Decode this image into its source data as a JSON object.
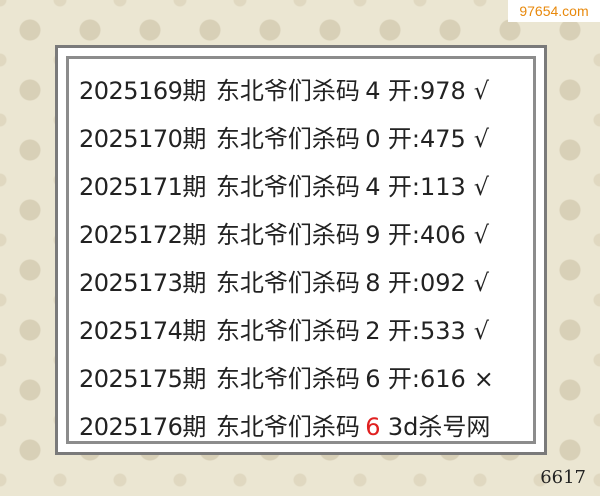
{
  "watermark": "97654.com",
  "rows": [
    {
      "period": "2025169期",
      "label": "东北爷们杀码",
      "kill": "4",
      "open": "开:978",
      "mark": "√"
    },
    {
      "period": "2025170期",
      "label": "东北爷们杀码",
      "kill": "0",
      "open": "开:475",
      "mark": "√"
    },
    {
      "period": "2025171期",
      "label": "东北爷们杀码",
      "kill": "4",
      "open": "开:113",
      "mark": "√"
    },
    {
      "period": "2025172期",
      "label": "东北爷们杀码",
      "kill": "9",
      "open": "开:406",
      "mark": "√"
    },
    {
      "period": "2025173期",
      "label": "东北爷们杀码",
      "kill": "8",
      "open": "开:092",
      "mark": "√"
    },
    {
      "period": "2025174期",
      "label": "东北爷们杀码",
      "kill": "2",
      "open": "开:533",
      "mark": "√"
    },
    {
      "period": "2025175期",
      "label": "东北爷们杀码",
      "kill": "6",
      "open": "开:616",
      "mark": "×"
    }
  ],
  "last_row": {
    "period": "2025176期",
    "label": "东北爷们杀码",
    "kill": "6",
    "site_prefix": "3d",
    "site_suffix": "杀号网"
  },
  "counter": "6617",
  "colors": {
    "highlight": "#e02020",
    "text": "#222222",
    "watermark": "#e8890c"
  }
}
